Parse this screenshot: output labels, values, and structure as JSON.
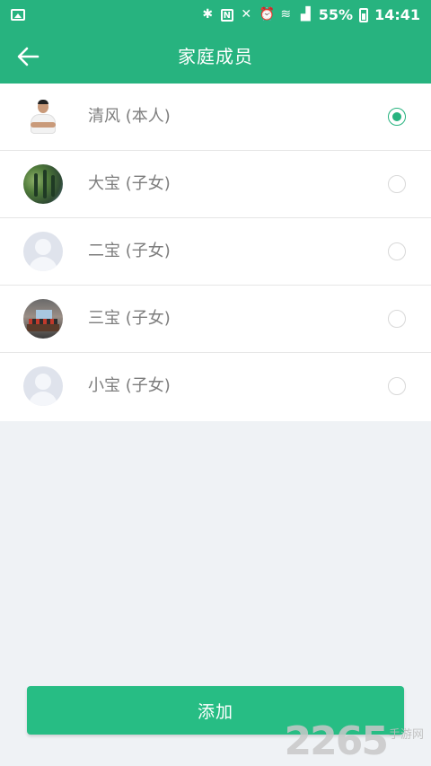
{
  "status_bar": {
    "battery": "55%",
    "time": "14:41",
    "icons": [
      "image-icon",
      "bluetooth-icon",
      "nfc-icon",
      "mute-icon",
      "alarm-icon",
      "wifi-icon",
      "signal-icon",
      "battery-icon"
    ]
  },
  "header": {
    "title": "家庭成员",
    "back_icon": "arrow-left-icon"
  },
  "members": [
    {
      "name": "清风 (本人)",
      "avatar": "photo-man",
      "selected": true
    },
    {
      "name": "大宝 (子女)",
      "avatar": "photo-forest",
      "selected": false
    },
    {
      "name": "二宝 (子女)",
      "avatar": "default-avatar",
      "selected": false
    },
    {
      "name": "三宝 (子女)",
      "avatar": "photo-room",
      "selected": false
    },
    {
      "name": "小宝 (子女)",
      "avatar": "default-avatar",
      "selected": false
    }
  ],
  "add_button": {
    "label": "添加"
  },
  "watermark": {
    "number": "2265",
    "site": "手游网"
  },
  "colors": {
    "accent": "#27b37f",
    "background": "#eff2f5"
  }
}
